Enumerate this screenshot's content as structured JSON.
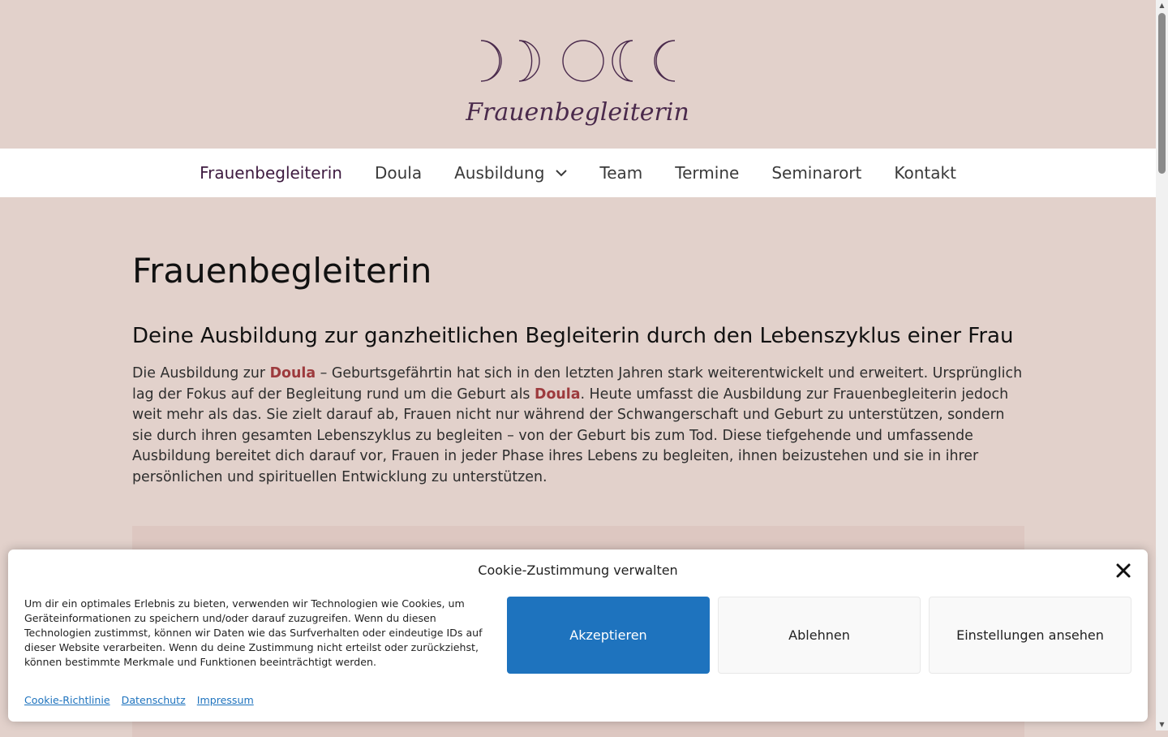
{
  "header": {
    "logo_text": "Frauenbegleiterin"
  },
  "nav": {
    "items": [
      {
        "label": "Frauenbegleiterin"
      },
      {
        "label": "Doula"
      },
      {
        "label": "Ausbildung"
      },
      {
        "label": "Team"
      },
      {
        "label": "Termine"
      },
      {
        "label": "Seminarort"
      },
      {
        "label": "Kontakt"
      }
    ],
    "active_color": "#3e1b40"
  },
  "main": {
    "title": "Frauenbegleiterin",
    "subtitle": "Deine Ausbildung zur ganzheitlichen Begleiterin durch den Lebenszyklus einer Frau",
    "paragraph": {
      "p1": "Die Ausbildung zur ",
      "link1": "Doula",
      "p2": " – Geburtsgefährtin hat sich in den letzten Jahren stark weiterentwickelt und erweitert. Ursprünglich lag der Fokus auf der Begleitung rund um die Geburt als ",
      "link2": "Doula",
      "p3": ". Heute umfasst die Ausbildung zur Frauenbegleiterin jedoch weit mehr als das. Sie zielt darauf ab, Frauen nicht nur während der Schwangerschaft und Geburt zu unterstützen, sondern sie durch ihren gesamten Lebenszyklus zu begleiten – von der Geburt bis zum Tod. Diese tiefgehende und umfassende Ausbildung bereitet dich darauf vor, Frauen in jeder Phase ihres Lebens zu begleiten, ihnen beizustehen und sie in ihrer persönlichen und spirituellen Entwicklung zu unterstützen."
    }
  },
  "cookie": {
    "title": "Cookie-Zustimmung verwalten",
    "text": "Um dir ein optimales Erlebnis zu bieten, verwenden wir Technologien wie Cookies, um Geräteinformationen zu speichern und/oder darauf zuzugreifen. Wenn du diesen Technologien zustimmst, können wir Daten wie das Surfverhalten oder eindeutige IDs auf dieser Website verarbeiten. Wenn du deine Zustimmung nicht erteilst oder zurückziehst, können bestimmte Merkmale und Funktionen beeinträchtigt werden.",
    "accept": "Akzeptieren",
    "deny": "Ablehnen",
    "settings": "Einstellungen ansehen",
    "links": [
      "Cookie-Richtlinie",
      "Datenschutz",
      "Impressum"
    ],
    "accent": "#1e73be"
  }
}
